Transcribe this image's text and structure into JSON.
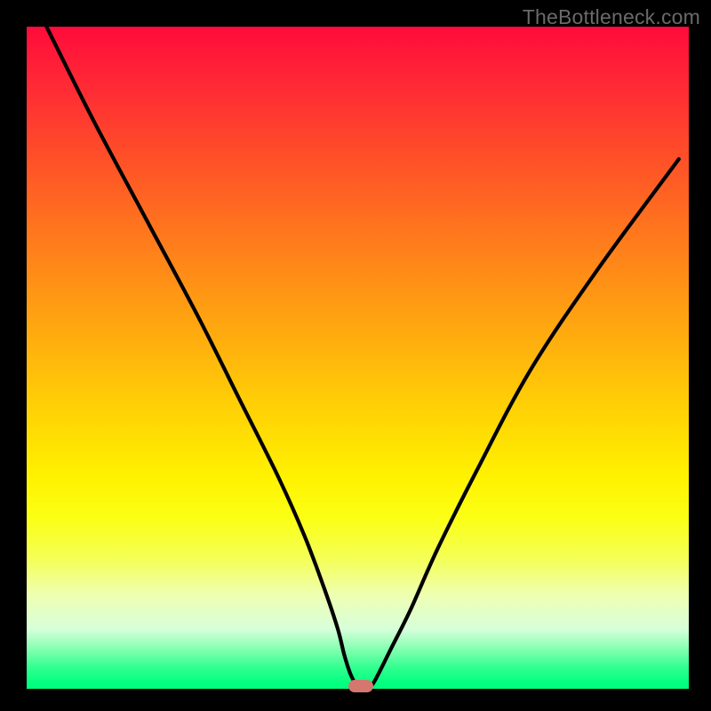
{
  "watermark": "TheBottleneck.com",
  "chart_data": {
    "type": "line",
    "title": "",
    "xlabel": "",
    "ylabel": "",
    "xlim": [
      0,
      100
    ],
    "ylim": [
      0,
      100
    ],
    "grid": false,
    "series": [
      {
        "name": "curve",
        "x": [
          3,
          10,
          18,
          26,
          32,
          38,
          42,
          45,
          47,
          48,
          49,
          50,
          51,
          52,
          53,
          55,
          58,
          62,
          68,
          76,
          86,
          98.5
        ],
        "values": [
          100,
          86,
          71,
          56,
          44,
          32,
          23,
          15,
          9,
          5,
          2,
          0.4,
          0.4,
          0.4,
          2,
          6,
          12,
          21,
          33,
          48,
          63,
          80
        ]
      }
    ],
    "marker": {
      "x": 50.5,
      "y": 0.4
    },
    "colors": {
      "curve": "#000000",
      "marker": "#d4776e",
      "gradient_stops": [
        {
          "pos": 0,
          "color": "#ff0b3b"
        },
        {
          "pos": 50,
          "color": "#ffd205"
        },
        {
          "pos": 75,
          "color": "#fbff13"
        },
        {
          "pos": 100,
          "color": "#00ff7d"
        }
      ]
    }
  }
}
